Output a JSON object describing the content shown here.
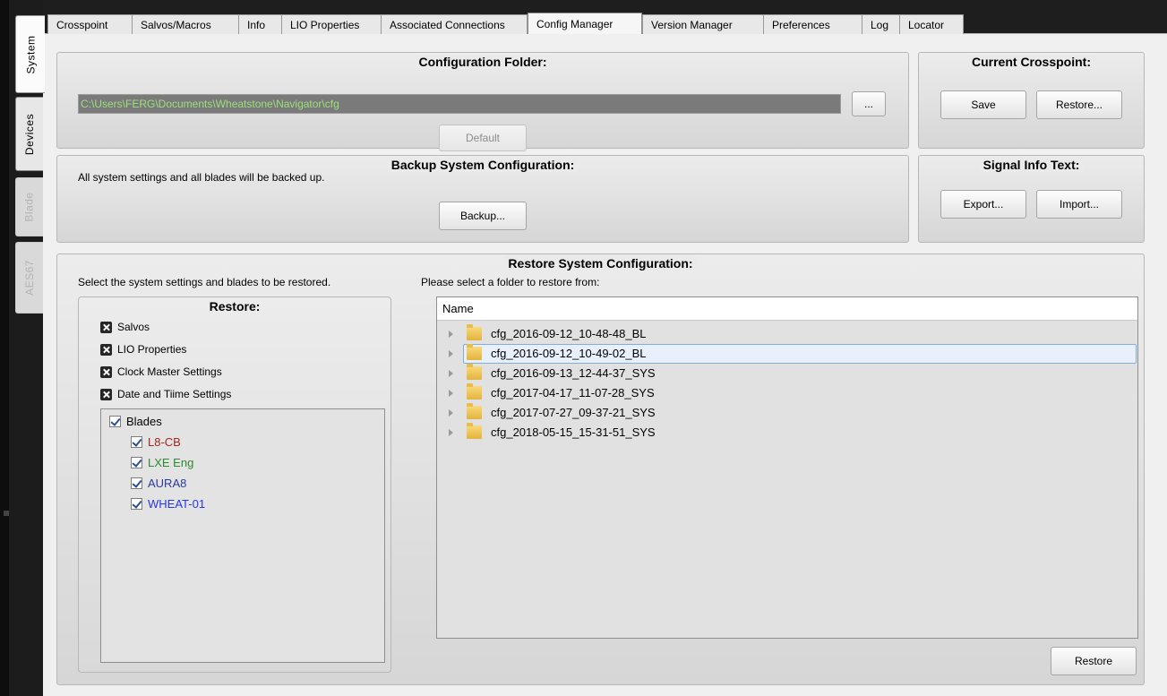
{
  "side_tabs": [
    {
      "label": "System",
      "state": "active"
    },
    {
      "label": "Devices",
      "state": "normal"
    },
    {
      "label": "Blade",
      "state": "disabled"
    },
    {
      "label": "AES67",
      "state": "disabled"
    }
  ],
  "top_tabs": [
    "Crosspoint",
    "Salvos/Macros",
    "Info",
    "LIO Properties",
    "Associated Connections",
    "Config Manager",
    "Version Manager",
    "Preferences",
    "Log",
    "Locator"
  ],
  "active_tab": "Config Manager",
  "config_folder": {
    "title": "Configuration Folder:",
    "path": "C:\\Users\\FERG\\Documents\\Wheatstone\\Navigator\\cfg",
    "browse_label": "...",
    "default_label": "Default"
  },
  "current_crosspoint": {
    "title": "Current Crosspoint:",
    "save_label": "Save",
    "restore_label": "Restore..."
  },
  "backup": {
    "title": "Backup System Configuration:",
    "description": "All system settings and all blades will be backed up.",
    "backup_label": "Backup..."
  },
  "signal_info": {
    "title": "Signal Info Text:",
    "export_label": "Export...",
    "import_label": "Import..."
  },
  "restore": {
    "title": "Restore System Configuration:",
    "left_instruction": "Select the system settings and blades to be restored.",
    "right_instruction": "Please select a folder to restore from:",
    "group_title": "Restore:",
    "options": [
      "Salvos",
      "LIO Properties",
      "Clock Master Settings",
      "Date and Tiime Settings"
    ],
    "blades_label": "Blades",
    "blades": [
      {
        "name": "L8-CB",
        "color": "#a0281e"
      },
      {
        "name": "LXE Eng",
        "color": "#2d8a2a"
      },
      {
        "name": "AURA8",
        "color": "#2a3a96"
      },
      {
        "name": "WHEAT-01",
        "color": "#2637e0"
      }
    ],
    "column_header": "Name",
    "folders": [
      "cfg_2016-09-12_10-48-48_BL",
      "cfg_2016-09-12_10-49-02_BL",
      "cfg_2016-09-13_12-44-37_SYS",
      "cfg_2017-04-17_11-07-28_SYS",
      "cfg_2017-07-27_09-37-21_SYS",
      "cfg_2018-05-15_15-31-51_SYS"
    ],
    "selected_folder": "cfg_2016-09-12_10-49-02_BL",
    "restore_button_label": "Restore"
  }
}
